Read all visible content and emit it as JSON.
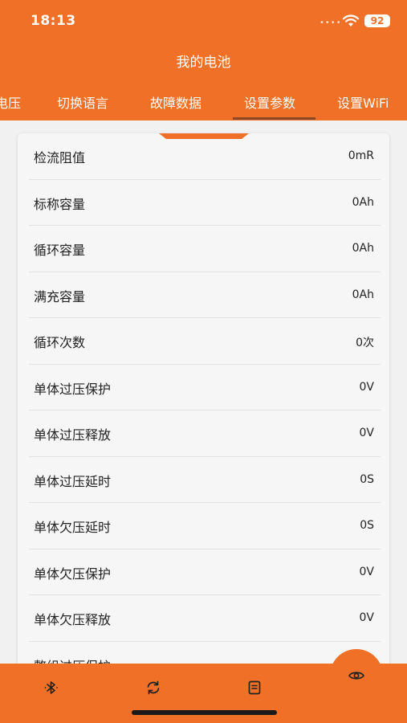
{
  "status_bar": {
    "time": "18:13",
    "signal": "••••",
    "battery": "92"
  },
  "header": {
    "title": "我的电池"
  },
  "tabs": [
    {
      "label": "电压"
    },
    {
      "label": "切换语言"
    },
    {
      "label": "故障数据"
    },
    {
      "label": "设置参数",
      "active": true
    },
    {
      "label": "设置WiFi"
    }
  ],
  "params": [
    {
      "label": "检流阻值",
      "value": "0mR"
    },
    {
      "label": "标称容量",
      "value": "0Ah"
    },
    {
      "label": "循环容量",
      "value": "0Ah"
    },
    {
      "label": "满充容量",
      "value": "0Ah"
    },
    {
      "label": "循环次数",
      "value": "0次"
    },
    {
      "label": "单体过压保护",
      "value": "0V"
    },
    {
      "label": "单体过压释放",
      "value": "0V"
    },
    {
      "label": "单体过压延时",
      "value": "0S"
    },
    {
      "label": "单体欠压延时",
      "value": "0S"
    },
    {
      "label": "单体欠压保护",
      "value": "0V"
    },
    {
      "label": "单体欠压释放",
      "value": "0V"
    },
    {
      "label": "整组过压保护",
      "value": ""
    }
  ],
  "bottom_nav": {
    "icons": [
      "bluetooth-icon",
      "refresh-icon",
      "document-icon"
    ],
    "fab_icon": "eye-icon"
  },
  "colors": {
    "accent": "#f07027",
    "background": "#f1f1f1",
    "card": "#f6f6f6",
    "tab_indicator": "#8a4a2a"
  }
}
